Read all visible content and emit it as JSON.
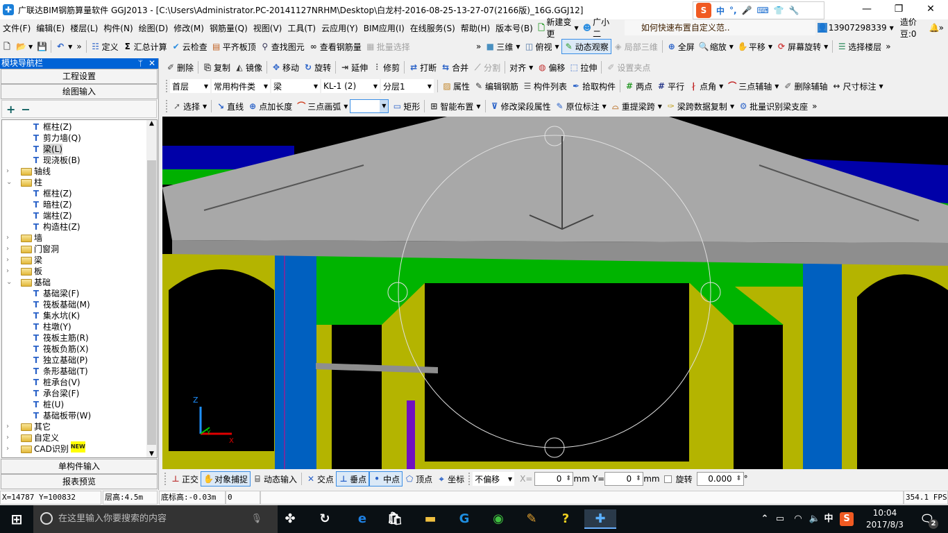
{
  "window": {
    "title": "广联达BIM钢筋算量软件 GGJ2013 - [C:\\Users\\Administrator.PC-20141127NRHM\\Desktop\\白龙村-2016-08-25-13-27-07(2166版)_16G.GGJ12]",
    "minimize": "—",
    "restore": "❐",
    "close": "✕"
  },
  "ime": {
    "lang": "中",
    "punct": "°,",
    "mic": "🎤",
    "keyboard": "⌨",
    "skin": "👕",
    "tools": "🔧"
  },
  "menus": [
    "文件(F)",
    "编辑(E)",
    "楼层(L)",
    "构件(N)",
    "绘图(D)",
    "修改(M)",
    "钢筋量(Q)",
    "视图(V)",
    "工具(T)",
    "云应用(Y)",
    "BIM应用(I)",
    "在线服务(S)",
    "帮助(H)",
    "版本号(B)"
  ],
  "menu_extra": {
    "new_change": "新建变更",
    "assistant": "广小二",
    "tip": "如何快速布置自定义范..",
    "account": "13907298339",
    "beans": "造价豆:0",
    "more": "»"
  },
  "toolbar1": [
    {
      "icon": "new-file",
      "label": ""
    },
    {
      "icon": "open-folder",
      "label": "",
      "dropdown": true
    },
    {
      "icon": "save",
      "label": ""
    },
    {
      "sep": true
    },
    {
      "icon": "undo",
      "label": "",
      "dropdown": true
    },
    {
      "icon": "more",
      "label": "»"
    },
    {
      "sep": true
    },
    {
      "icon": "define",
      "label": "定义"
    },
    {
      "icon": "sigma",
      "label": "汇总计算"
    },
    {
      "icon": "cloud-check",
      "label": "云检查"
    },
    {
      "icon": "align-slab",
      "label": "平齐板顶"
    },
    {
      "icon": "binoculars",
      "label": "查找图元"
    },
    {
      "icon": "glasses",
      "label": "查看钢筋量"
    },
    {
      "icon": "batch-select",
      "label": "批量选择",
      "disabled": true
    }
  ],
  "toolbar1b": [
    {
      "icon": "more",
      "label": "»"
    },
    {
      "icon": "cube",
      "label": "三维",
      "dropdown": true
    },
    {
      "icon": "top-view",
      "label": "俯视",
      "dropdown": true
    },
    {
      "icon": "orbit",
      "label": "动态观察",
      "active": true
    },
    {
      "icon": "local-3d",
      "label": "局部三维",
      "disabled": true
    },
    {
      "sep": true
    },
    {
      "icon": "fullscreen",
      "label": "全屏"
    },
    {
      "icon": "zoom",
      "label": "缩放",
      "dropdown": true
    },
    {
      "icon": "pan",
      "label": "平移",
      "dropdown": true
    },
    {
      "icon": "rotate-screen",
      "label": "屏幕旋转",
      "dropdown": true
    },
    {
      "sep": true
    },
    {
      "icon": "select-floor",
      "label": "选择楼层"
    },
    {
      "icon": "more",
      "label": "»"
    }
  ],
  "toolbar2": [
    {
      "icon": "delete",
      "label": "删除"
    },
    {
      "sep": true
    },
    {
      "icon": "copy",
      "label": "复制"
    },
    {
      "icon": "mirror",
      "label": "镜像"
    },
    {
      "sep": true
    },
    {
      "icon": "move",
      "label": "移动"
    },
    {
      "icon": "rotate",
      "label": "旋转"
    },
    {
      "sep": true
    },
    {
      "icon": "extend",
      "label": "延伸"
    },
    {
      "icon": "trim",
      "label": "修剪"
    },
    {
      "sep": true
    },
    {
      "icon": "break",
      "label": "打断"
    },
    {
      "icon": "merge",
      "label": "合并"
    },
    {
      "icon": "split",
      "label": "分割",
      "disabled": true
    },
    {
      "sep": true
    },
    {
      "icon": "align",
      "label": "对齐",
      "dropdown": true
    },
    {
      "icon": "offset",
      "label": "偏移"
    },
    {
      "icon": "stretch",
      "label": "拉伸"
    },
    {
      "sep": true
    },
    {
      "icon": "set-grip",
      "label": "设置夹点",
      "disabled": true
    }
  ],
  "toolbar3": {
    "combos": [
      "首层",
      "常用构件类",
      "梁",
      "KL-1 (2)",
      "分层1"
    ],
    "items": [
      {
        "sep": true
      },
      {
        "icon": "properties",
        "label": "属性"
      },
      {
        "icon": "edit-rebar",
        "label": "编辑钢筋"
      },
      {
        "icon": "component-list",
        "label": "构件列表"
      },
      {
        "icon": "pick",
        "label": "拾取构件"
      },
      {
        "sep": true
      },
      {
        "icon": "two-point",
        "label": "两点"
      },
      {
        "icon": "parallel",
        "label": "平行"
      },
      {
        "icon": "point-angle",
        "label": "点角",
        "dropdown": true
      },
      {
        "icon": "three-point-axis",
        "label": "三点辅轴",
        "dropdown": true
      },
      {
        "icon": "delete-axis",
        "label": "删除辅轴"
      },
      {
        "icon": "dimension",
        "label": "尺寸标注",
        "dropdown": true
      }
    ]
  },
  "toolbar4": {
    "items_a": [
      {
        "icon": "pointer",
        "label": "选择",
        "dropdown": true
      },
      {
        "sep": true
      },
      {
        "icon": "line",
        "label": "直线"
      },
      {
        "icon": "point-length",
        "label": "点加长度"
      },
      {
        "icon": "arc",
        "label": "三点画弧",
        "dropdown": true
      }
    ],
    "combo": "",
    "items_b": [
      {
        "icon": "rectangle",
        "label": "矩形"
      },
      {
        "sep": true
      },
      {
        "icon": "smart-place",
        "label": "智能布置",
        "dropdown": true
      },
      {
        "sep": true
      },
      {
        "icon": "modify-span",
        "label": "修改梁段属性"
      },
      {
        "icon": "in-situ-label",
        "label": "原位标注",
        "dropdown": true
      },
      {
        "icon": "re-span",
        "label": "重提梁跨",
        "dropdown": true
      },
      {
        "icon": "copy-span",
        "label": "梁跨数据复制",
        "dropdown": true
      },
      {
        "icon": "batch-support",
        "label": "批量识别梁支座"
      },
      {
        "icon": "more",
        "label": "»"
      }
    ]
  },
  "nav": {
    "title": "模块导航栏",
    "pin": "ᛘ",
    "close": "✕",
    "btn_project": "工程设置",
    "btn_draw": "绘图输入",
    "btn_single": "单构件输入",
    "btn_report": "报表预览",
    "expand": "+",
    "collapse": "−"
  },
  "tree": [
    {
      "level": 2,
      "label": "框柱(Z)",
      "icon": "column"
    },
    {
      "level": 2,
      "label": "剪力墙(Q)",
      "icon": "shear-wall"
    },
    {
      "level": 2,
      "label": "梁(L)",
      "icon": "beam",
      "selected": true
    },
    {
      "level": 2,
      "label": "现浇板(B)",
      "icon": "slab"
    },
    {
      "level": 1,
      "label": "轴线",
      "expanded": false
    },
    {
      "level": 1,
      "label": "柱",
      "expanded": true
    },
    {
      "level": 2,
      "label": "框柱(Z)",
      "icon": "column"
    },
    {
      "level": 2,
      "label": "暗柱(Z)",
      "icon": "column"
    },
    {
      "level": 2,
      "label": "端柱(Z)",
      "icon": "column"
    },
    {
      "level": 2,
      "label": "构造柱(Z)",
      "icon": "constructional-column"
    },
    {
      "level": 1,
      "label": "墙",
      "expanded": false
    },
    {
      "level": 1,
      "label": "门窗洞",
      "expanded": false
    },
    {
      "level": 1,
      "label": "梁",
      "expanded": false
    },
    {
      "level": 1,
      "label": "板",
      "expanded": false
    },
    {
      "level": 1,
      "label": "基础",
      "expanded": true
    },
    {
      "level": 2,
      "label": "基础梁(F)",
      "icon": "foundation-beam"
    },
    {
      "level": 2,
      "label": "筏板基础(M)",
      "icon": "raft"
    },
    {
      "level": 2,
      "label": "集水坑(K)",
      "icon": "sump"
    },
    {
      "level": 2,
      "label": "柱墩(Y)",
      "icon": "pier"
    },
    {
      "level": 2,
      "label": "筏板主筋(R)",
      "icon": "raft-main-rebar"
    },
    {
      "level": 2,
      "label": "筏板负筋(X)",
      "icon": "raft-neg-rebar"
    },
    {
      "level": 2,
      "label": "独立基础(P)",
      "icon": "isolated-footing"
    },
    {
      "level": 2,
      "label": "条形基础(T)",
      "icon": "strip-footing"
    },
    {
      "level": 2,
      "label": "桩承台(V)",
      "icon": "pile-cap"
    },
    {
      "level": 2,
      "label": "承台梁(F)",
      "icon": "cap-beam"
    },
    {
      "level": 2,
      "label": "桩(U)",
      "icon": "pile"
    },
    {
      "level": 2,
      "label": "基础板带(W)",
      "icon": "slab-strip"
    },
    {
      "level": 1,
      "label": "其它",
      "expanded": false
    },
    {
      "level": 1,
      "label": "自定义",
      "expanded": false
    },
    {
      "level": 1,
      "label": "CAD识别",
      "expanded": false,
      "badge": "NEW"
    }
  ],
  "viewport": {
    "axis_z": "Z",
    "axis_x": "X",
    "axis_y": "Y"
  },
  "snapbar": {
    "items": [
      {
        "icon": "orthogonal",
        "label": "正交"
      },
      {
        "icon": "object-snap",
        "label": "对象捕捉",
        "active": true
      },
      {
        "icon": "dynamic-input",
        "label": "动态输入"
      },
      {
        "sep": true
      },
      {
        "icon": "intersection",
        "label": "交点"
      },
      {
        "icon": "perpendicular",
        "label": "垂点",
        "active": true
      },
      {
        "icon": "midpoint",
        "label": "中点",
        "active": true
      },
      {
        "icon": "vertex",
        "label": "顶点"
      },
      {
        "icon": "coordinate",
        "label": "坐标"
      }
    ],
    "offset_mode": "不偏移",
    "x_label": "X=",
    "x_value": "0",
    "y_label": "Y=",
    "y_value": "0",
    "unit": "mm",
    "rotate_label": "旋转",
    "rotate_value": "0.000",
    "degree": "°",
    "rotate_checked": false
  },
  "status": {
    "coords": "X=14787 Y=100832",
    "floor_height": "层高:4.5m",
    "bottom_elev": "底标高:-0.03m",
    "value": "0",
    "fps": "354.1 FPS"
  },
  "taskbar": {
    "search_placeholder": "在这里输入你要搜索的内容",
    "time": "10:04",
    "date": "2017/8/3",
    "ime_lang": "中",
    "notifications": "2"
  },
  "colors": {
    "accent": "#0063d6",
    "wall": "#b4b400",
    "beam": "#00b400",
    "column": "#0060c0",
    "roof": "#a8a8a8"
  }
}
